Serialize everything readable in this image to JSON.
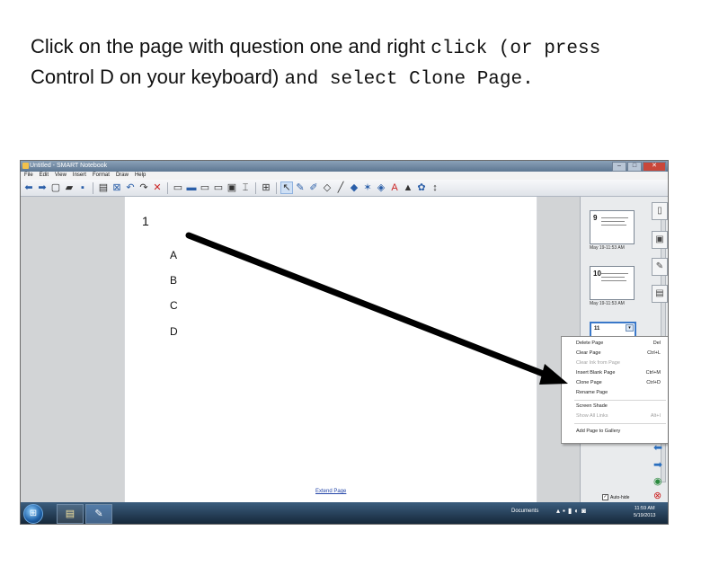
{
  "instruction": {
    "line1_text": "Click on the page with question one and right ",
    "line1_mono": "click (or press",
    "line2_text": "Control D on your keyboard) ",
    "line2_mono": "and select Clone Page."
  },
  "window": {
    "title": "Untitled - SMART Notebook",
    "minimize": "–",
    "maximize": "□",
    "close": "✕"
  },
  "menu": [
    "File",
    "Edit",
    "View",
    "Insert",
    "Format",
    "Draw",
    "Help"
  ],
  "page": {
    "question_number": "1",
    "options": [
      "A",
      "B",
      "C",
      "D"
    ],
    "extend_link": "Extend Page"
  },
  "page_sorter": {
    "thumbnails": [
      {
        "number": "9",
        "caption": "May 19-11:53 AM"
      },
      {
        "number": "10",
        "caption": "May 19-11:53 AM"
      },
      {
        "number": "11",
        "caption": ""
      }
    ],
    "dropdown_glyph": "▾",
    "auto_hide_label": "Auto-hide",
    "auto_hide_checked": "✓"
  },
  "context_menu": [
    {
      "label": "Delete Page",
      "shortcut": "Del",
      "enabled": true
    },
    {
      "label": "Clear Page",
      "shortcut": "Ctrl+L",
      "enabled": true
    },
    {
      "label": "Clear Ink from Page",
      "shortcut": "",
      "enabled": false
    },
    {
      "label": "Insert Blank Page",
      "shortcut": "Ctrl+M",
      "enabled": true
    },
    {
      "label": "Clone Page",
      "shortcut": "Ctrl+D",
      "enabled": true
    },
    {
      "label": "Rename Page",
      "shortcut": "",
      "enabled": true
    },
    {
      "label": "Screen Shade",
      "shortcut": "",
      "enabled": true
    },
    {
      "label": "Show All Links",
      "shortcut": "Alt+I",
      "enabled": false
    },
    {
      "label": "Add Page to Gallery",
      "shortcut": "",
      "enabled": true
    }
  ],
  "taskbar": {
    "start_glyph": "⊞",
    "docs_label": "Documents",
    "time": "11:59 AM",
    "date": "5/19/2013"
  },
  "colors": {
    "arrow": "#000000",
    "title_bar": "#5d7691",
    "selection_border": "#3a78c9"
  }
}
